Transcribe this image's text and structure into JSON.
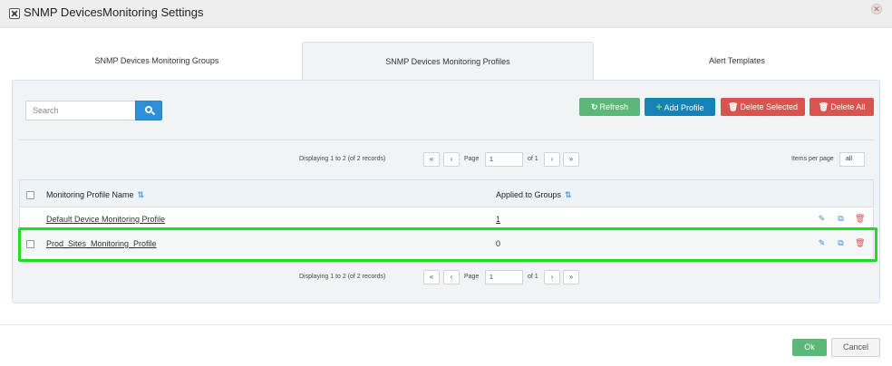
{
  "dialog": {
    "title": "SNMP DevicesMonitoring Settings",
    "title_icon": "settings-icon",
    "close_icon": "close-icon"
  },
  "tabs": [
    {
      "label": "SNMP Devices Monitoring Groups",
      "active": false
    },
    {
      "label": "SNMP Devices Monitoring Profiles",
      "active": true
    },
    {
      "label": "Alert Templates",
      "active": false
    }
  ],
  "search": {
    "placeholder": "Search",
    "value": ""
  },
  "actions": {
    "refresh": "Refresh",
    "add_profile": "Add Profile",
    "delete_selected": "Delete Selected",
    "delete_all": "Delete All"
  },
  "pager": {
    "info": "Displaying 1 to 2 (of 2 records)",
    "page_label": "Page",
    "page_value": "1",
    "of_label": "of 1",
    "first": "«",
    "prev": "‹",
    "next": "›",
    "last": "»",
    "items_per_page_label": "Items per page",
    "items_per_page_value": "all"
  },
  "table": {
    "columns": [
      "Monitoring Profile Name",
      "Applied to Groups"
    ],
    "rows": [
      {
        "name": "Default Device Monitoring Profile",
        "applied": "1"
      },
      {
        "name": "Prod_Sites_Monitoring_Profile",
        "applied": "0"
      }
    ]
  },
  "footer": {
    "ok": "Ok",
    "cancel": "Cancel"
  },
  "colors": {
    "refresh": "#5cb878",
    "add": "#1782b9",
    "delete": "#d9534f",
    "highlight": "#22dd22"
  }
}
